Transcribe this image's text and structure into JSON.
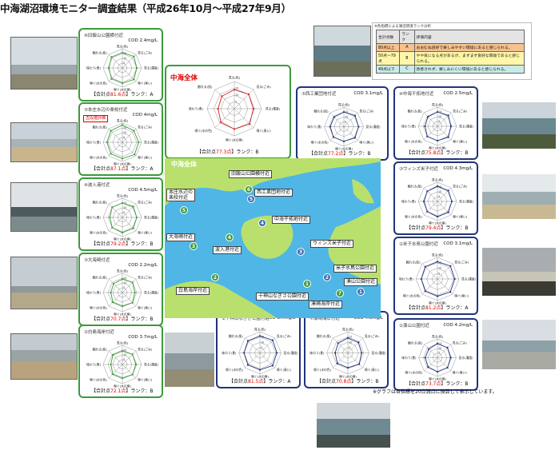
{
  "title": "中海湖沼環境モニター調査結果（平成26年10月～平成27年9月）",
  "footnote": "※グラフは各指標を20点満点に換算して表示しています。",
  "axes": [
    "見る\n(色)",
    "見る\n(ごみ)",
    "見る\n(濁度)",
    "嗅ぐ\n(臭い)",
    "嗅ぐ(水)\n(臭)",
    "嗅ぐ(水)\n(色)",
    "味わう\n(食の味)",
    "触れる\n(肌の具合)"
  ],
  "axes_short": [
    "見る(色)",
    "見る(ごみ)",
    "見る(濁度)",
    "嗅ぐ(臭い)",
    "嗅ぐ(水の臭)",
    "嗅ぐ(水の色)",
    "味わう(食)",
    "触れる(肌)"
  ],
  "ticks": [
    "15",
    "10",
    "5"
  ],
  "overall": {
    "label": "中海全体",
    "score_prefix": "【合計点",
    "score": "77.3点",
    "rank_text": "】ランク：B",
    "values": [
      14,
      15,
      14,
      16,
      15,
      14,
      12,
      13
    ],
    "color": "#d42020"
  },
  "rank_legend": {
    "title": "※各指標による湖沼環境ランク分析",
    "headers": [
      "合計点数",
      "ランク",
      "評価内容"
    ],
    "rows": [
      {
        "range": "80点以上",
        "rank": "A",
        "desc": "おおむね良好で楽しみやすい環境にあると感じられる。",
        "bg": "#f6c28f"
      },
      {
        "range": "50点～79点",
        "rank": "B",
        "desc": "やや気になる点があるが、まずまず良好な環境であると感じられる。",
        "bg": "#fff6a8"
      },
      {
        "range": "49点以下",
        "rank": "C",
        "desc": "改善されず、楽しみにくい環境にあると感じられる。",
        "bg": "#c9ebe8"
      }
    ]
  },
  "sites": [
    {
      "id": "site6",
      "name": "⑥旧飯山公園横付近",
      "cod": "COD 2.4mg/L",
      "score": "81.6点",
      "rank": "A",
      "values": [
        16,
        17,
        15,
        17,
        16,
        16,
        14,
        16
      ],
      "tag": ""
    },
    {
      "id": "site5",
      "name": "⑤本庄水辺の楽校付近",
      "cod": "COD 4mg/L",
      "score": "87.1点",
      "rank": "A",
      "values": [
        18,
        17,
        17,
        18,
        17,
        17,
        16,
        17
      ],
      "tag": "五段階評価"
    },
    {
      "id": "site4",
      "name": "④波入港付近",
      "cod": "COD 4.5mg/L",
      "score": "79.2点",
      "rank": "B",
      "values": [
        15,
        16,
        15,
        16,
        16,
        15,
        13,
        15
      ],
      "tag": ""
    },
    {
      "id": "site3",
      "name": "③大海崎付近",
      "cod": "COD 2.2mg/L",
      "score": "70.7点",
      "rank": "B",
      "values": [
        14,
        15,
        13,
        15,
        14,
        14,
        12,
        13
      ],
      "tag": ""
    },
    {
      "id": "site2",
      "name": "②白島海岸付近",
      "cod": "COD 3.7mg/L",
      "score": "72.1点",
      "rank": "B",
      "values": [
        14,
        15,
        14,
        15,
        14,
        14,
        12,
        14
      ],
      "tag": ""
    },
    {
      "id": "site1",
      "name": "①十神山なぎさ公園付近",
      "cod": "COD 3.7mg/L",
      "score": "81.5点",
      "rank": "A",
      "values": [
        16,
        17,
        16,
        17,
        16,
        16,
        15,
        16
      ],
      "tag": ""
    },
    {
      "id": "site7",
      "name": "⑦湊崎海岸付近",
      "cod": "COD 4.3mg/L",
      "score": "70.8点",
      "rank": "B",
      "values": [
        14,
        14,
        13,
        15,
        14,
        14,
        12,
        13
      ],
      "tag": ""
    },
    {
      "id": "siteE1",
      "name": "①湊山公園付近",
      "cod": "COD 4.2mg/L",
      "score": "73.7点",
      "rank": "B",
      "values": [
        15,
        15,
        14,
        15,
        15,
        14,
        13,
        13
      ],
      "tag": ""
    },
    {
      "id": "siteE2",
      "name": "②米子水鳥公園付近",
      "cod": "COD 3.1mg/L",
      "score": "81.2点",
      "rank": "A",
      "values": [
        16,
        17,
        16,
        17,
        16,
        16,
        15,
        16
      ],
      "tag": ""
    },
    {
      "id": "siteE3",
      "name": "③ウィンズ米子付近",
      "cod": "COD 4.3mg/L",
      "score": "79.4点",
      "rank": "B",
      "values": [
        16,
        16,
        15,
        16,
        16,
        15,
        14,
        15
      ],
      "tag": ""
    },
    {
      "id": "siteE4",
      "name": "④中海干拓地付近",
      "cod": "COD 2.5mg/L",
      "score": "75.8点",
      "rank": "B",
      "values": [
        15,
        16,
        14,
        16,
        15,
        15,
        13,
        14
      ],
      "tag": ""
    },
    {
      "id": "siteE5",
      "name": "⑤西工業団地付近",
      "cod": "COD 3.1mg/L",
      "score": "77.2点",
      "rank": "B",
      "values": [
        15,
        16,
        15,
        16,
        15,
        15,
        14,
        14
      ],
      "tag": ""
    }
  ],
  "score_prefix": "【合計点",
  "rank_prefix": "】ランク：",
  "map": {
    "overall_label": "中海全体",
    "labels": [
      "旧飯山公園横付近",
      "西工業団地付近",
      "中海干拓地付近",
      "本庄水辺の\n楽校付近",
      "大海崎付近",
      "波入港付近",
      "ウィンズ米子付近",
      "米子水鳥公園付近",
      "湊山公園付近",
      "白島海岸付近",
      "十神山なぎさ公園付近",
      "湊崎海岸付近"
    ],
    "markers": [
      "6",
      "5",
      "4",
      "5",
      "3",
      "4",
      "3",
      "2",
      "1",
      "2",
      "1",
      "7"
    ]
  },
  "colors": {
    "green": "#3c9a3c",
    "blue": "#22337a",
    "red": "#d42020",
    "lake": "#4fb6e6",
    "land": "#b9e06d"
  }
}
